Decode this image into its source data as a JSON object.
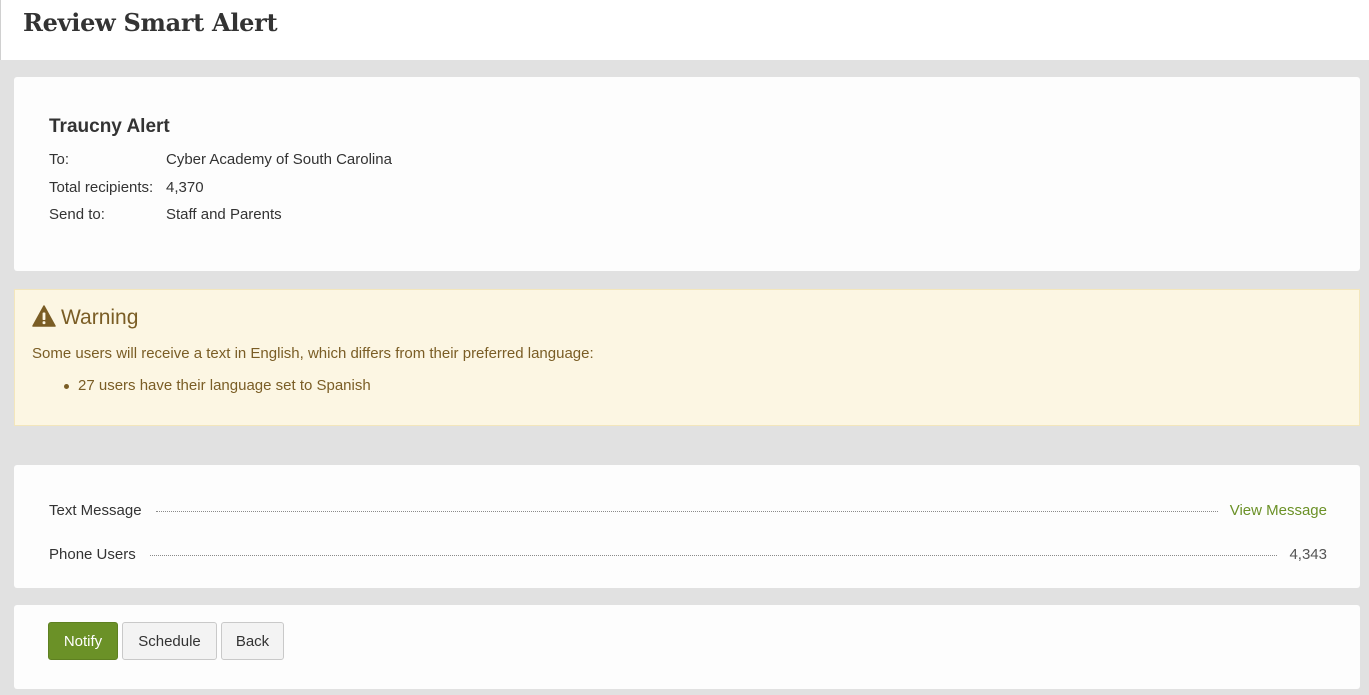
{
  "header": {
    "title": "Review Smart Alert"
  },
  "summary": {
    "alert_title": "Traucny Alert",
    "to_label": "To:",
    "to_value": "Cyber Academy of South Carolina",
    "total_label": "Total recipients:",
    "total_value": "4,370",
    "send_label": "Send to:",
    "send_value": "Staff and Parents"
  },
  "warning": {
    "icon": "warning-triangle-icon",
    "title": "Warning",
    "message": "Some users will receive a text in English, which differs from their preferred language:",
    "items": [
      "27 users have their language set to Spanish"
    ]
  },
  "delivery": {
    "text_message_label": "Text Message",
    "view_message_link": "View Message",
    "phone_users_label": "Phone Users",
    "phone_users_count": "4,343"
  },
  "actions": {
    "notify_label": "Notify",
    "schedule_label": "Schedule",
    "back_label": "Back"
  },
  "colors": {
    "page_background": "#e1e1e1",
    "card_background": "#fdfdfd",
    "accent_green": "#6b9127",
    "warning_background": "#fcf6e3",
    "warning_text": "#7a5d25"
  }
}
